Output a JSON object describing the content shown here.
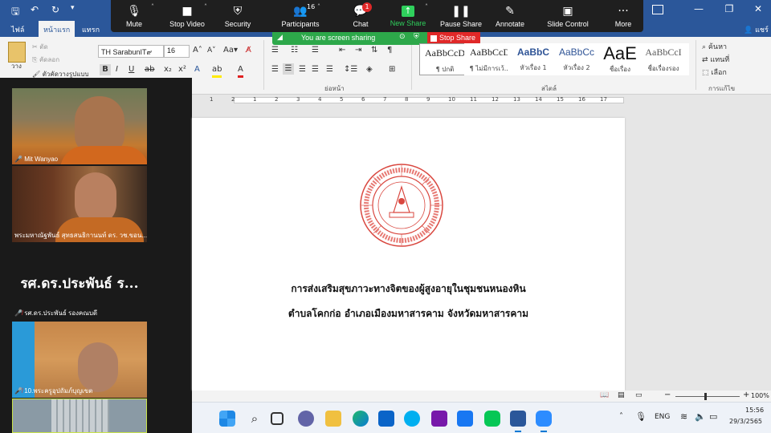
{
  "word": {
    "tabs": [
      "ไฟล์",
      "หน้าแรก",
      "แทรก"
    ],
    "active_tab": "หน้าแรก",
    "right_tab": "แชร์",
    "font_name": "TH SarabunIT๙",
    "font_size": "16",
    "clipboard": {
      "cut": "ตัด",
      "copy": "คัดลอก",
      "format_painter": "ตัวคัดวางรูปแบบ",
      "paste": "วาง"
    },
    "group_labels": {
      "paragraph": "ย่อหน้า",
      "styles": "สไตล์",
      "editing": "การแก้ไข"
    },
    "styles": [
      {
        "preview": "AaBbCcD",
        "label": "¶ ปกติ",
        "color": "#222222"
      },
      {
        "preview": "AaBbCcD",
        "label": "¶ ไม่มีการเว้...",
        "color": "#222222"
      },
      {
        "preview": "AaBbC",
        "label": "หัวเรื่อง 1",
        "color": "#2f5496"
      },
      {
        "preview": "AaBbCc",
        "label": "หัวเรื่อง 2",
        "color": "#2f5496"
      },
      {
        "preview": "AaE",
        "label": "ชื่อเรื่อง",
        "color": "#111111"
      },
      {
        "preview": "AaBbCcI",
        "label": "ชื่อเรื่องรอง",
        "color": "#595959"
      }
    ],
    "editing": {
      "find": "ค้นหา",
      "replace": "แทนที่",
      "select": "เลือก"
    },
    "document": {
      "line1": "การส่งเสริมสุขภาวะทางจิตของผู้สูงอายุในชุมชนหนองหิน",
      "line2": "ตำบลโคกก่อ อำเภอเมืองมหาสารคาม จังหวัดมหาสารคาม"
    },
    "ruler_numbers": [
      "1",
      "2",
      "1",
      "2",
      "3",
      "4",
      "5",
      "6",
      "7",
      "8",
      "9",
      "10",
      "11",
      "12",
      "13",
      "14",
      "15",
      "16",
      "17"
    ],
    "zoom": "100%"
  },
  "zoom": {
    "buttons": [
      {
        "label": "Mute",
        "icon": "mic-icon"
      },
      {
        "label": "Stop Video",
        "icon": "video-icon"
      },
      {
        "label": "Security",
        "icon": "shield-icon"
      },
      {
        "label": "Participants",
        "icon": "participants-icon"
      },
      {
        "label": "Chat",
        "icon": "chat-icon"
      },
      {
        "label": "New Share",
        "icon": "share-icon"
      },
      {
        "label": "Pause Share",
        "icon": "pause-icon"
      },
      {
        "label": "Annotate",
        "icon": "pen-icon"
      },
      {
        "label": "Slide Control",
        "icon": "slide-icon"
      },
      {
        "label": "More",
        "icon": "more-icon"
      }
    ],
    "participants_count": "16",
    "chat_badge": "1",
    "sharing_text": "You are screen sharing",
    "stop_share": "Stop Share",
    "new_share_color": "#2fd05c"
  },
  "gallery": {
    "tiles": [
      {
        "name": "Mit Wanyao",
        "muted": false
      },
      {
        "name": "พระมหาณัฐพันธ์ สุทธสนธิกานนท์ ดร. วช.ขอน...",
        "muted": false
      },
      {
        "name": "รศ.ดร.ประพันธ์ รองคณบดี",
        "muted": true,
        "display_text": "รศ.ดร.ประพันธ์ ร..."
      },
      {
        "name": "10.พระครูอุปถัมภ์บุญเขต",
        "muted": true
      }
    ]
  },
  "taskbar": {
    "lang": "ENG",
    "time": "15:56",
    "date": "29/3/2565",
    "accent": "#0078d4"
  }
}
